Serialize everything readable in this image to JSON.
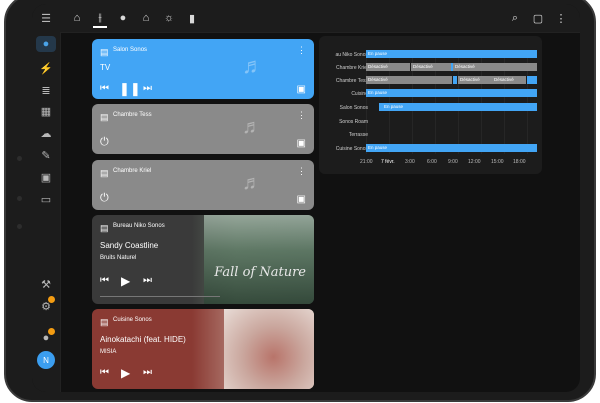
{
  "sidebar": {
    "items": [
      {
        "icon": "menu-icon",
        "glyph": "☰"
      },
      {
        "icon": "person-icon",
        "glyph": "●"
      },
      {
        "icon": "bolt-icon",
        "glyph": "⚡"
      },
      {
        "icon": "list-icon",
        "glyph": "≣"
      },
      {
        "icon": "calendar-icon",
        "glyph": "▦"
      },
      {
        "icon": "cloud-icon",
        "glyph": "☁"
      },
      {
        "icon": "wrench-icon",
        "glyph": "✎"
      },
      {
        "icon": "media-icon",
        "glyph": "▣"
      },
      {
        "icon": "terminal-icon",
        "glyph": "▭"
      }
    ],
    "bottom": [
      {
        "icon": "hammer-icon",
        "glyph": "⚒"
      },
      {
        "icon": "settings-icon",
        "glyph": "⚙"
      },
      {
        "icon": "notifications-icon",
        "glyph": "●"
      }
    ],
    "avatar_initial": "N"
  },
  "topbar": {
    "tabs": [
      {
        "icon": "home-icon",
        "glyph": "⌂"
      },
      {
        "icon": "mixer-icon",
        "glyph": "⫲"
      },
      {
        "icon": "user-icon",
        "glyph": "●"
      },
      {
        "icon": "house-tab-icon",
        "glyph": "⌂"
      },
      {
        "icon": "light-icon",
        "glyph": "☼"
      },
      {
        "icon": "trash-icon",
        "glyph": "▮"
      }
    ],
    "actions": [
      {
        "icon": "search-icon",
        "glyph": "⌕"
      },
      {
        "icon": "chat-icon",
        "glyph": "▢"
      },
      {
        "icon": "more-vert-icon",
        "glyph": "⋮"
      }
    ]
  },
  "cards": [
    {
      "name": "Salon Sonos",
      "title": "TV",
      "subtitle": "",
      "bg": "#42a5f5"
    },
    {
      "name": "Chambre Tess",
      "title": "",
      "subtitle": "",
      "bg": "#8a8a8a"
    },
    {
      "name": "Chambre Kriel",
      "title": "",
      "subtitle": "",
      "bg": "#8a8a8a"
    },
    {
      "name": "Bureau Niko Sonos",
      "title": "Sandy Coastline",
      "subtitle": "Bruits Naturel",
      "bg": "#3d3d3d",
      "art_text": "Fall of Nature"
    },
    {
      "name": "Cuisine Sonos",
      "title": "Ainokatachi (feat. HIDE)",
      "subtitle": "MISIA",
      "bg": "#8a3a33"
    }
  ],
  "timeline": {
    "rows": [
      {
        "label": "au Niko Sonos",
        "segments": [
          {
            "text": "En pause",
            "color": "#42a5f5"
          }
        ]
      },
      {
        "label": "Chambre Kriel",
        "segments": [
          {
            "text": "Désactivé"
          },
          {
            "text": "Désactivé"
          },
          {
            "text": "Désactivé"
          }
        ]
      },
      {
        "label": "Chambre Tess",
        "segments": [
          {
            "text": "Désactivé"
          },
          {
            "text": "Désactivé"
          },
          {
            "text": "Désactivé"
          }
        ]
      },
      {
        "label": "Cuisine",
        "segments": [
          {
            "text": "En pause"
          }
        ]
      },
      {
        "label": "Salon Sonos",
        "segments": [
          {
            "text": "En pause"
          }
        ]
      },
      {
        "label": "Sonos Roam",
        "segments": []
      },
      {
        "label": "Terrasse",
        "segments": []
      },
      {
        "label": "Cuisine Sonos",
        "segments": [
          {
            "text": "En pause"
          }
        ]
      }
    ],
    "ticks": [
      "21:00",
      "7 févr.",
      "3:00",
      "6:00",
      "9:00",
      "12:00",
      "15:00",
      "18:00"
    ]
  }
}
